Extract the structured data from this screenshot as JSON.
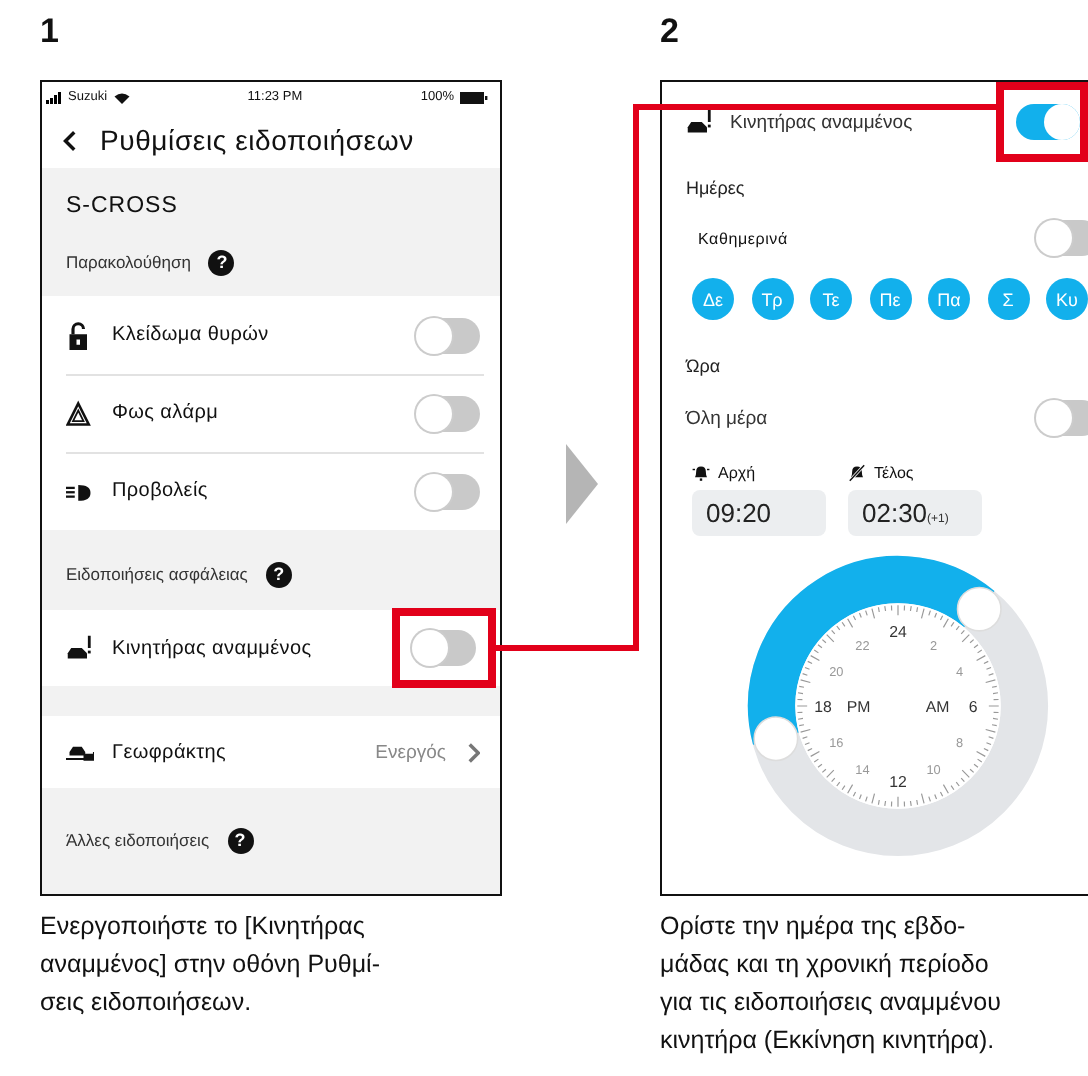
{
  "steps": [
    {
      "number": "1",
      "caption_lines": [
        "Ενεργοποιήστε το [Κινητήρας",
        "αναμμένος] στην οθόνη Ρυθμί-",
        "σεις ειδοποιήσεων."
      ]
    },
    {
      "number": "2",
      "caption_lines": [
        "Ορίστε την ημέρα της εβδο-",
        "μάδας και τη χρονική περίοδο",
        "για τις ειδοποιήσεις αναμμένου",
        "κινητήρα (Εκκίνηση κινητήρα)."
      ]
    }
  ],
  "screen_1": {
    "status_bar": {
      "carrier": "Suzuki",
      "time": "11:23 PM",
      "battery": "100%"
    },
    "title": "Ρυθμίσεις ειδοποιήσεων",
    "items": [
      {
        "kind": "vehicle",
        "label": "S-CROSS"
      },
      {
        "kind": "section",
        "label": "Παρακολούθηση",
        "help": "?"
      },
      {
        "kind": "toggle",
        "label": "Κλείδωμα θυρών",
        "on": false,
        "highlighted": false
      },
      {
        "kind": "toggle",
        "label": "Φως αλάρμ",
        "on": false,
        "highlighted": false
      },
      {
        "kind": "toggle",
        "label": "Προβολείς",
        "on": false,
        "highlighted": false
      },
      {
        "kind": "section",
        "label": "Ειδοποιήσεις ασφάλειας",
        "help": "?"
      },
      {
        "kind": "toggle",
        "label": "Κινητήρας αναμμένος",
        "on": false,
        "highlighted": true
      },
      {
        "kind": "link",
        "label": "Γεωφράκτης",
        "value": "Ενεργός"
      },
      {
        "kind": "section",
        "label": "Άλλες ειδοποιήσεις",
        "help": "?"
      }
    ]
  },
  "screen_2": {
    "header": {
      "label": "Κινητήρας αναμμένος",
      "on": true,
      "highlighted": true
    },
    "days_label": "Ημέρες",
    "weekdays": {
      "label": "Καθημερινά",
      "on": false
    },
    "days": [
      {
        "label": "Δε",
        "selected": true
      },
      {
        "label": "Τρ",
        "selected": true
      },
      {
        "label": "Τε",
        "selected": true
      },
      {
        "label": "Πε",
        "selected": true
      },
      {
        "label": "Πα",
        "selected": true
      },
      {
        "label": "Σ",
        "selected": true
      },
      {
        "label": "Κυ",
        "selected": true
      }
    ],
    "time_label": "Ώρα",
    "all_day": {
      "label": "Όλη μέρα",
      "on": false
    },
    "start": {
      "label": "Αρχή",
      "value": "09:20"
    },
    "end": {
      "label": "Τέλος",
      "value": "02:30",
      "suffix": "(+1)"
    },
    "dial_hours": [
      "24",
      "2",
      "4",
      "6",
      "8",
      "10",
      "12",
      "14",
      "16",
      "18",
      "20",
      "22"
    ],
    "dial_pm": "PM",
    "dial_am": "AM"
  }
}
